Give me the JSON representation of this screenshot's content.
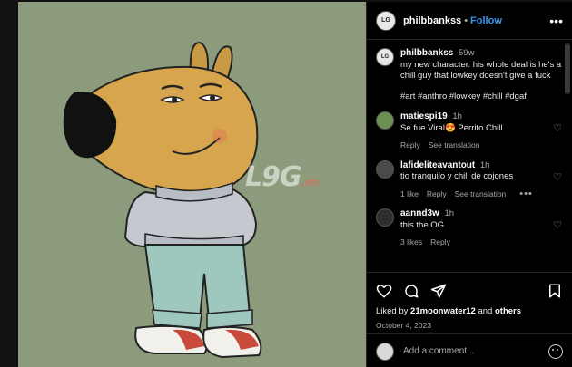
{
  "post": {
    "username": "philbbankss",
    "follow_label": "Follow",
    "separator": "•",
    "more_icon": "more-dots-icon"
  },
  "watermark": {
    "main": "L9G",
    "suffix": ".vn"
  },
  "caption": {
    "username": "philbbankss",
    "time": "59w",
    "text": "my new character. his whole deal is he's a chill guy that lowkey doesn't give a fuck",
    "tags": "#art #anthro #lowkey #chill #dgaf"
  },
  "comments": [
    {
      "username": "matiespi19",
      "time": "1h",
      "text": "Se fue Viral😍 Perrito Chill",
      "actions": [
        "Reply",
        "See translation"
      ]
    },
    {
      "username": "lafideliteavantout",
      "time": "1h",
      "text": "tio tranquilo y chill de cojones",
      "actions": [
        "1 like",
        "Reply",
        "See translation"
      ],
      "more": "•••"
    },
    {
      "username": "aannd3w",
      "time": "1h",
      "text": "this the OG",
      "actions": [
        "3 likes",
        "Reply"
      ]
    }
  ],
  "likes": {
    "prefix": "Liked by ",
    "user": "21moonwater12",
    "middle": " and ",
    "others": "others"
  },
  "date": "October 4, 2023",
  "add_comment": {
    "placeholder": "Add a comment..."
  },
  "icons": [
    "heart-icon",
    "comment-icon",
    "share-icon",
    "bookmark-icon",
    "emoji-icon"
  ]
}
